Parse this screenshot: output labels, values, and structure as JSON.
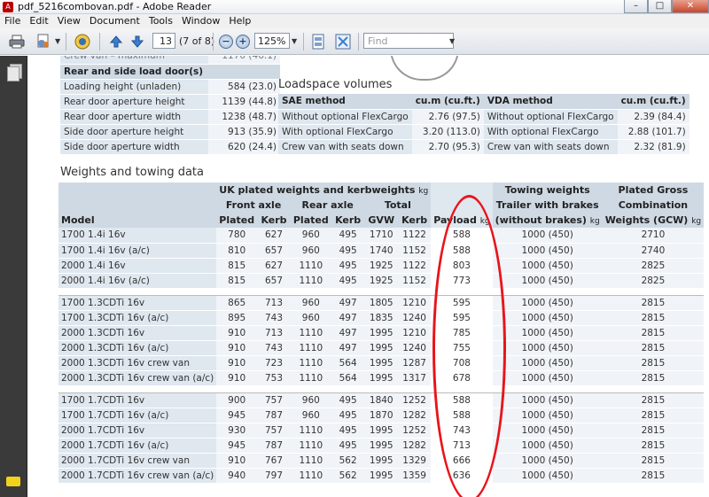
{
  "window": {
    "title": "pdf_5216combovan.pdf - Adobe Reader",
    "minimize": "–",
    "maximize": "□",
    "close": "✕"
  },
  "menu": [
    "File",
    "Edit",
    "View",
    "Document",
    "Tools",
    "Window",
    "Help"
  ],
  "toolbar": {
    "page_current": "13",
    "page_label": "(7 of 8)",
    "zoom_value": "125%",
    "find_placeholder": "Find"
  },
  "rear_doors": {
    "faint_row": {
      "label": "Crew van – maximum",
      "value": "1170 (46.1)"
    },
    "header": "Rear and side load door(s)",
    "rows": [
      {
        "label": "Loading height (unladen)",
        "value": "584 (23.0)"
      },
      {
        "label": "Rear door aperture height",
        "value": "1139 (44.8)"
      },
      {
        "label": "Rear door aperture width",
        "value": "1238 (48.7)"
      },
      {
        "label": "Side door aperture height",
        "value": "913 (35.9)"
      },
      {
        "label": "Side door aperture width",
        "value": "620 (24.4)"
      }
    ]
  },
  "loadspace": {
    "title": "Loadspace volumes",
    "headers": [
      "SAE method",
      "cu.m (cu.ft.)",
      "VDA method",
      "cu.m (cu.ft.)"
    ],
    "rows": [
      [
        "Without optional FlexCargo",
        "2.76 (97.5)",
        "Without optional FlexCargo",
        "2.39 (84.4)"
      ],
      [
        "With optional FlexCargo",
        "3.20 (113.0)",
        "With optional FlexCargo",
        "2.88 (101.7)"
      ],
      [
        "Crew van with seats down",
        "2.70 (95.3)",
        "Crew van with seats down",
        "2.32 (81.9)"
      ]
    ]
  },
  "weights": {
    "title": "Weights and towing data",
    "head1": {
      "uk": "UK plated weights and kerbweights",
      "uk_unit": "kg",
      "towing": "Towing weights",
      "gross": "Plated Gross"
    },
    "head2": {
      "front": "Front axle",
      "rear": "Rear axle",
      "total": "Total",
      "towing": "Trailer with brakes",
      "gross": "Combination"
    },
    "head3": {
      "model": "Model",
      "plated1": "Plated",
      "kerb1": "Kerb",
      "plated2": "Plated",
      "kerb2": "Kerb",
      "gvw": "GVW",
      "kerb3": "Kerb",
      "payload": "Payload",
      "payload_unit": "kg",
      "towing": "(without brakes)",
      "towing_unit": "kg",
      "gross": "Weights (GCW)",
      "gross_unit": "kg"
    },
    "groups": [
      [
        [
          "1700 1.4i 16v",
          "780",
          "627",
          "960",
          "495",
          "1710",
          "1122",
          "588",
          "1000 (450)",
          "2710"
        ],
        [
          "1700 1.4i 16v (a/c)",
          "810",
          "657",
          "960",
          "495",
          "1740",
          "1152",
          "588",
          "1000 (450)",
          "2740"
        ],
        [
          "2000 1.4i 16v",
          "815",
          "627",
          "1110",
          "495",
          "1925",
          "1122",
          "803",
          "1000 (450)",
          "2825"
        ],
        [
          "2000 1.4i 16v (a/c)",
          "815",
          "657",
          "1110",
          "495",
          "1925",
          "1152",
          "773",
          "1000 (450)",
          "2825"
        ]
      ],
      [
        [
          "1700 1.3CDTi 16v",
          "865",
          "713",
          "960",
          "497",
          "1805",
          "1210",
          "595",
          "1000 (450)",
          "2815"
        ],
        [
          "1700 1.3CDTi 16v (a/c)",
          "895",
          "743",
          "960",
          "497",
          "1835",
          "1240",
          "595",
          "1000 (450)",
          "2815"
        ],
        [
          "2000 1.3CDTi 16v",
          "910",
          "713",
          "1110",
          "497",
          "1995",
          "1210",
          "785",
          "1000 (450)",
          "2815"
        ],
        [
          "2000 1.3CDTi 16v (a/c)",
          "910",
          "743",
          "1110",
          "497",
          "1995",
          "1240",
          "755",
          "1000 (450)",
          "2815"
        ],
        [
          "2000 1.3CDTi 16v crew van",
          "910",
          "723",
          "1110",
          "564",
          "1995",
          "1287",
          "708",
          "1000 (450)",
          "2815"
        ],
        [
          "2000 1.3CDTi 16v crew van (a/c)",
          "910",
          "753",
          "1110",
          "564",
          "1995",
          "1317",
          "678",
          "1000 (450)",
          "2815"
        ]
      ],
      [
        [
          "1700 1.7CDTi 16v",
          "900",
          "757",
          "960",
          "495",
          "1840",
          "1252",
          "588",
          "1000 (450)",
          "2815"
        ],
        [
          "1700 1.7CDTi 16v (a/c)",
          "945",
          "787",
          "960",
          "495",
          "1870",
          "1282",
          "588",
          "1000 (450)",
          "2815"
        ],
        [
          "2000 1.7CDTi 16v",
          "930",
          "757",
          "1110",
          "495",
          "1995",
          "1252",
          "743",
          "1000 (450)",
          "2815"
        ],
        [
          "2000 1.7CDTi 16v (a/c)",
          "945",
          "787",
          "1110",
          "495",
          "1995",
          "1282",
          "713",
          "1000 (450)",
          "2815"
        ],
        [
          "2000 1.7CDTi 16v crew van",
          "910",
          "767",
          "1110",
          "562",
          "1995",
          "1329",
          "666",
          "1000 (450)",
          "2815"
        ],
        [
          "2000 1.7CDTi 16v crew van (a/c)",
          "940",
          "797",
          "1110",
          "562",
          "1995",
          "1359",
          "636",
          "1000 (450)",
          "2815"
        ]
      ]
    ]
  },
  "colors": {
    "annotation_ellipse": "#e8141b",
    "table_header": "#cfd9e4",
    "table_label_cell": "#dfe7ef",
    "table_value_cell": "#f0f4f8"
  }
}
